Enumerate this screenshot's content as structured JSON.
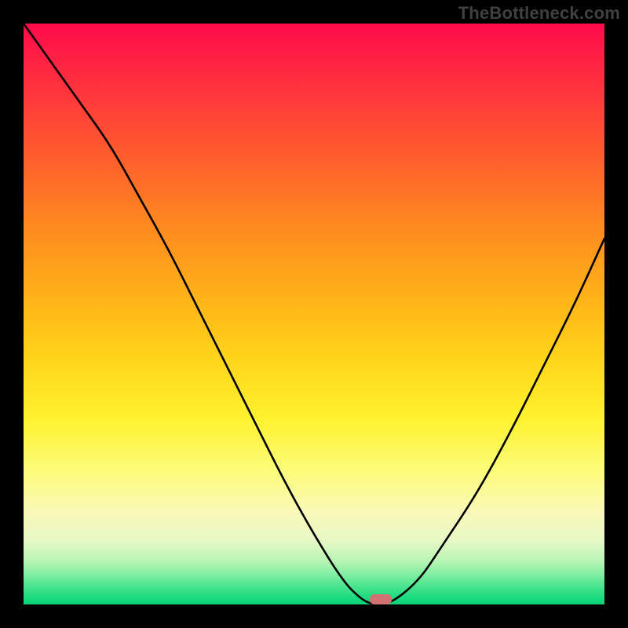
{
  "watermark": "TheBottleneck.com",
  "chart_data": {
    "type": "line",
    "title": "",
    "xlabel": "",
    "ylabel": "",
    "xlim": [
      0,
      1
    ],
    "ylim": [
      0,
      1
    ],
    "x_axis_meaning": "component balance position (normalized)",
    "y_axis_meaning": "bottleneck severity (0 = no bottleneck, 1 = maximum)",
    "background_gradient": {
      "orientation": "vertical",
      "stops": [
        {
          "pos": 0.0,
          "color": "#ff0a4a"
        },
        {
          "pos": 0.35,
          "color": "#ff8a1f"
        },
        {
          "pos": 0.68,
          "color": "#fff22e"
        },
        {
          "pos": 0.97,
          "color": "#3fe28a"
        },
        {
          "pos": 1.0,
          "color": "#0bd576"
        }
      ]
    },
    "x": [
      0.0,
      0.05,
      0.1,
      0.15,
      0.2,
      0.25,
      0.3,
      0.35,
      0.4,
      0.45,
      0.5,
      0.55,
      0.58,
      0.6,
      0.63,
      0.68,
      0.72,
      0.78,
      0.84,
      0.9,
      0.95,
      1.0
    ],
    "values": [
      1.0,
      0.93,
      0.86,
      0.79,
      0.7,
      0.61,
      0.51,
      0.41,
      0.31,
      0.21,
      0.12,
      0.04,
      0.01,
      0.0,
      0.0,
      0.04,
      0.1,
      0.19,
      0.3,
      0.42,
      0.52,
      0.63
    ],
    "optimal_point": {
      "x": 0.615,
      "y": 0.0
    }
  }
}
